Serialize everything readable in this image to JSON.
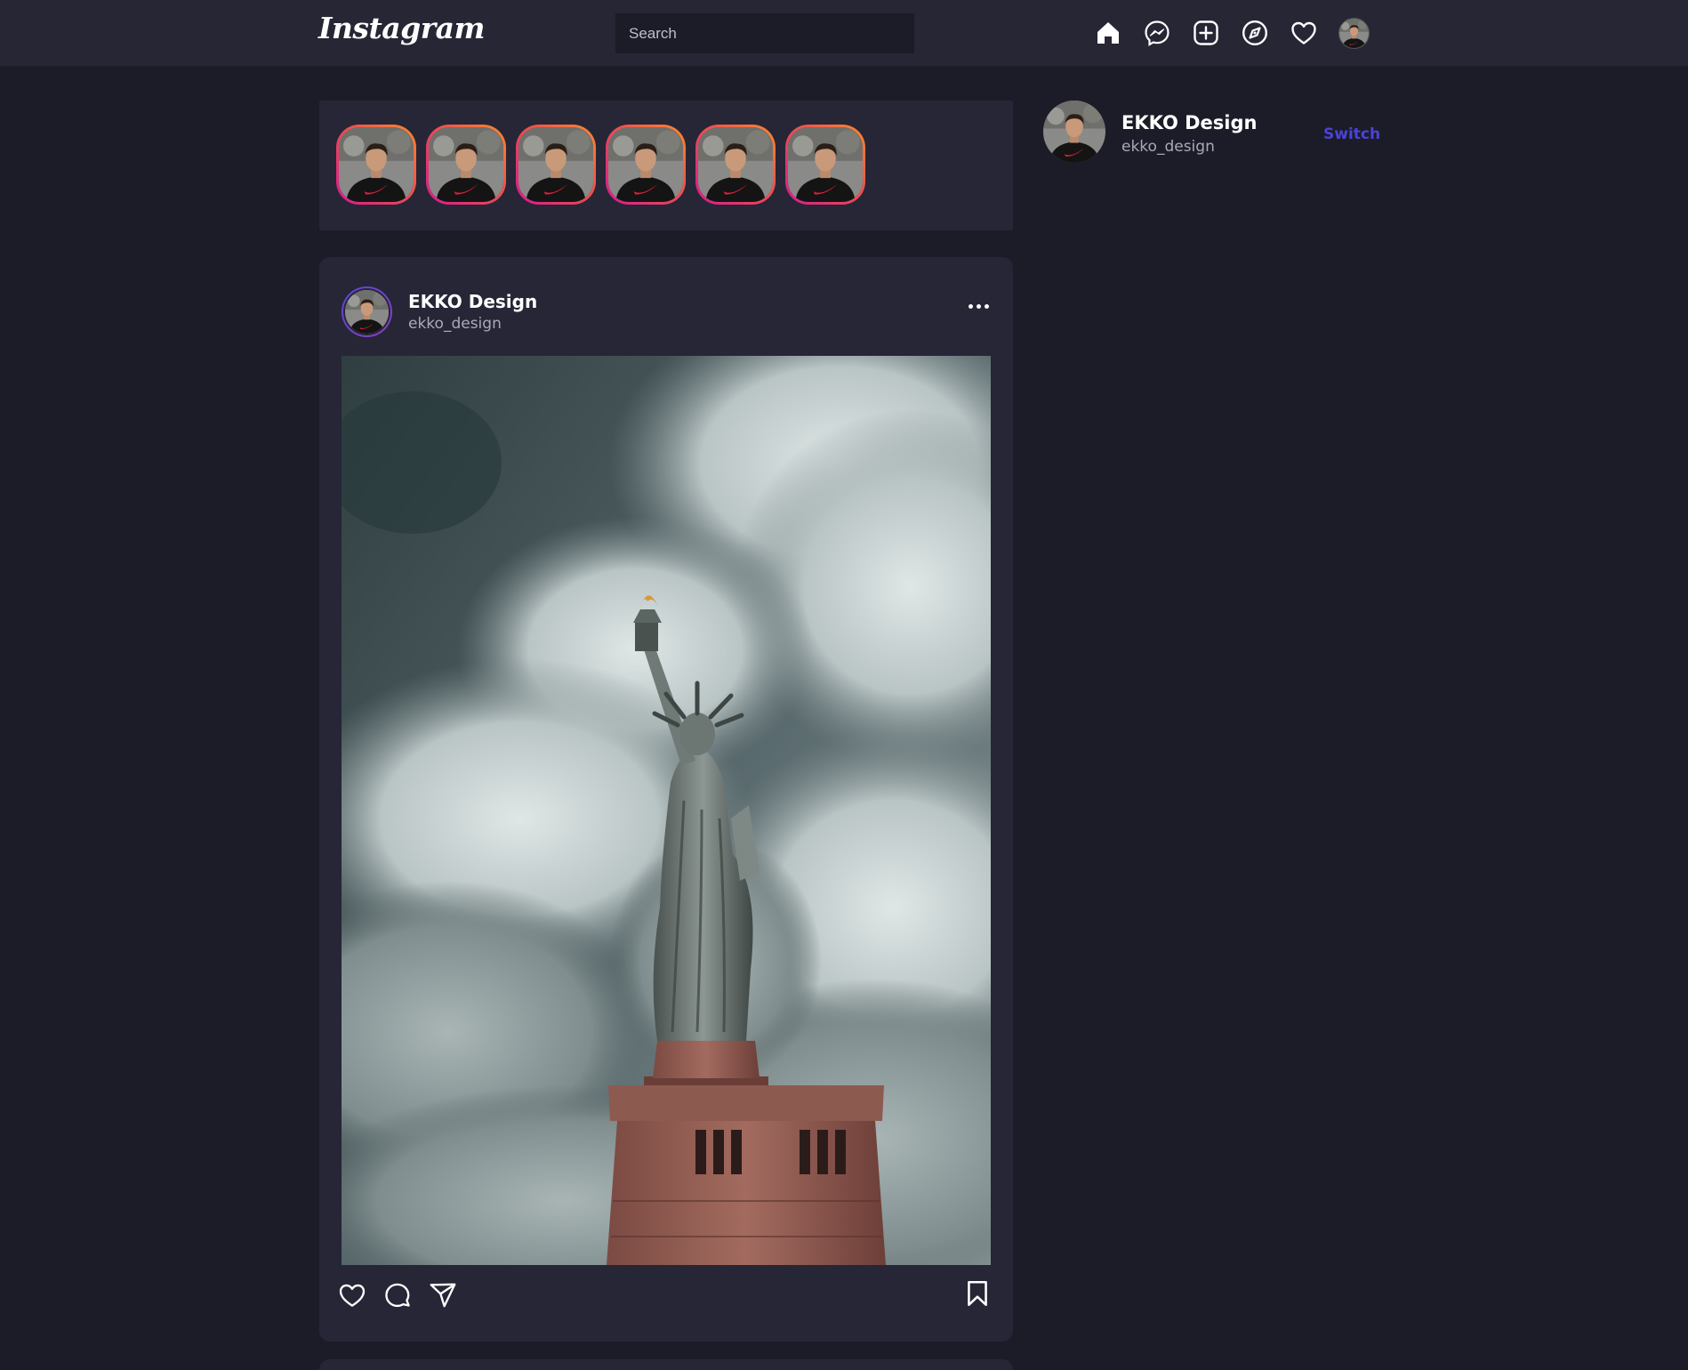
{
  "header": {
    "logo_text": "Instagram",
    "search_placeholder": "Search",
    "nav_icons": [
      "home-icon",
      "messenger-icon",
      "new-post-icon",
      "explore-compass-icon",
      "activity-heart-icon",
      "profile-avatar"
    ]
  },
  "stories": {
    "count": 6,
    "ring_colors": [
      "#d81b8f",
      "#f0544a",
      "#f98a2c"
    ]
  },
  "post": {
    "author_name": "EKKO Design",
    "author_handle": "ekko_design",
    "image_subject": "statue-of-liberty",
    "actions": [
      "like-heart-icon",
      "comment-bubble-icon",
      "share-send-icon",
      "save-bookmark-icon"
    ]
  },
  "sidebar": {
    "name": "EKKO Design",
    "handle": "ekko_design",
    "switch_label": "Switch"
  },
  "colors": {
    "background": "#1c1c29",
    "card": "#262636",
    "accent": "#4b43d6",
    "secondary_text": "#a9a9b7"
  }
}
